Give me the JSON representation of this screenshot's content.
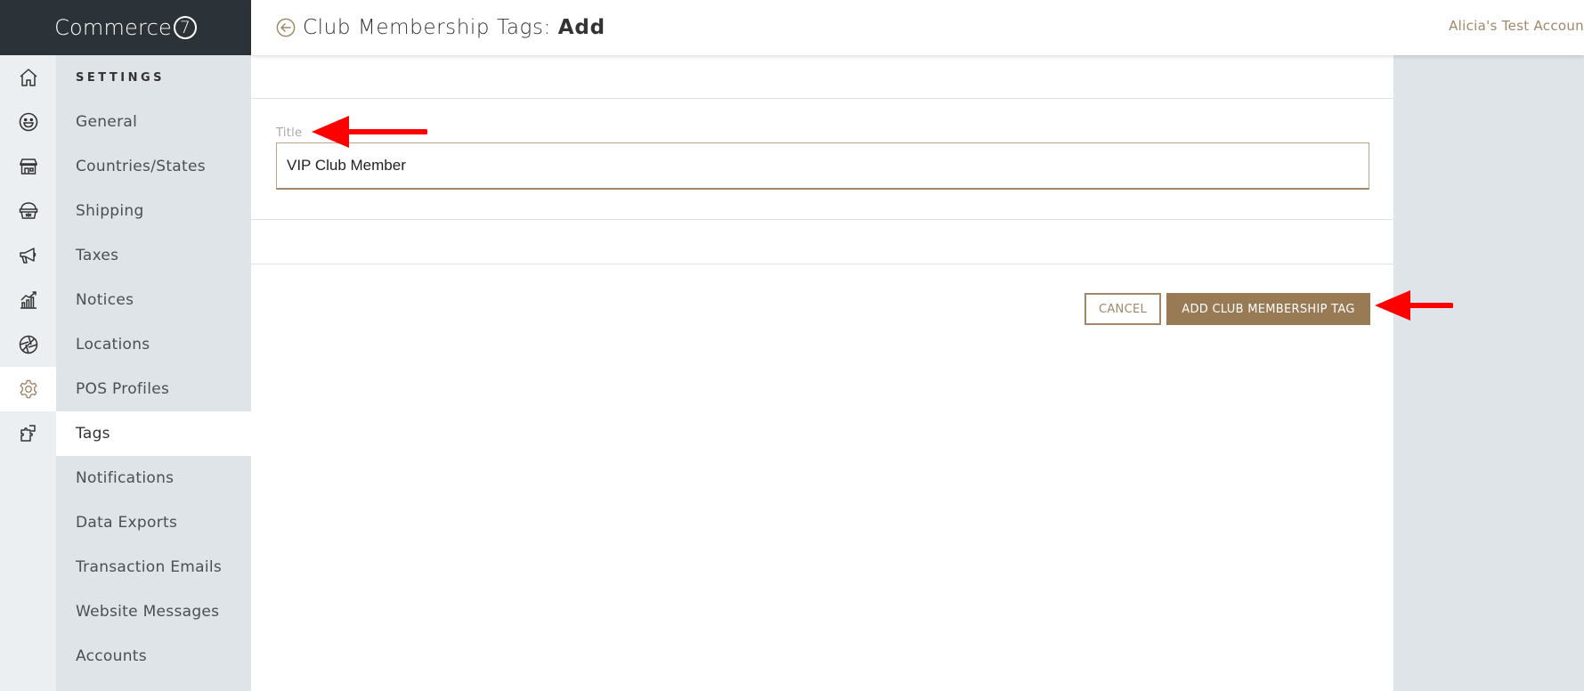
{
  "app": {
    "brand_name": "Commerce",
    "brand_mark": "7",
    "account_name": "Alicia's Test Accoun"
  },
  "header": {
    "title_prefix": "Club Membership Tags:",
    "title_action": "Add"
  },
  "rail": {
    "items": [
      {
        "icon": "home-icon"
      },
      {
        "icon": "smiley-icon"
      },
      {
        "icon": "store-icon"
      },
      {
        "icon": "basket-icon"
      },
      {
        "icon": "megaphone-icon"
      },
      {
        "icon": "chart-icon"
      },
      {
        "icon": "aperture-icon"
      },
      {
        "icon": "gear-icon",
        "active": true
      },
      {
        "icon": "puzzle-icon"
      }
    ]
  },
  "submenu": {
    "heading": "SETTINGS",
    "items": [
      {
        "label": "General"
      },
      {
        "label": "Countries/States"
      },
      {
        "label": "Shipping"
      },
      {
        "label": "Taxes"
      },
      {
        "label": "Notices"
      },
      {
        "label": "Locations"
      },
      {
        "label": "POS Profiles"
      },
      {
        "label": "Tags",
        "active": true
      },
      {
        "label": "Notifications"
      },
      {
        "label": "Data Exports"
      },
      {
        "label": "Transaction Emails"
      },
      {
        "label": "Website Messages"
      },
      {
        "label": "Accounts"
      }
    ]
  },
  "form": {
    "title_label": "Title",
    "title_value": "VIP Club Member"
  },
  "actions": {
    "cancel_label": "CANCEL",
    "submit_label": "ADD CLUB MEMBERSHIP TAG"
  },
  "colors": {
    "accent": "#987a55",
    "sidebar_dark": "#2c3338",
    "annotation_arrow": "#ff0000"
  }
}
